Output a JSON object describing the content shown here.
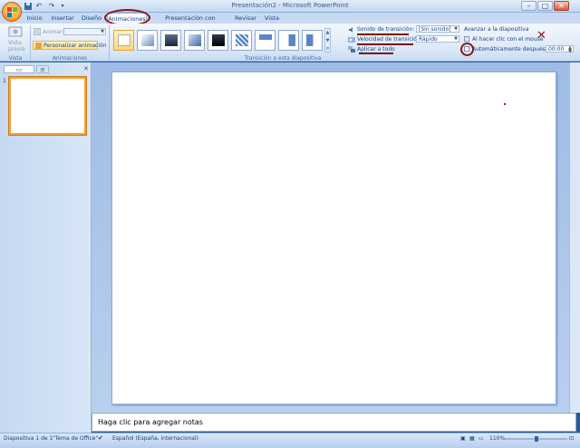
{
  "window": {
    "title": "Presentación2 - Microsoft PowerPoint",
    "min": "–",
    "max": "□",
    "close": "✕"
  },
  "tabs": [
    "Inicio",
    "Insertar",
    "Diseño",
    "Animaciones",
    "Presentación con diapositivas",
    "Revisar",
    "Vista"
  ],
  "ribbon": {
    "preview": {
      "label1": "Vista",
      "label2": "previa",
      "group": "Vista pre..."
    },
    "animations": {
      "animar": "Animar:",
      "custom": "Personalizar animación",
      "group": "Animaciones"
    },
    "transition": {
      "group": "Transición a esta diapositiva",
      "sound_label": "Sonido de transición:",
      "sound_value": "[Sin sonido]",
      "speed_label": "Velocidad de transición:",
      "speed_value": "Rápido",
      "apply_all": "Aplicar a todo"
    },
    "advance": {
      "title": "Avanzar a la diapositiva",
      "on_click": "Al hacer clic con el mouse",
      "auto": "Automáticamente después de:",
      "time": "00:00"
    }
  },
  "panel": {
    "slide_number": "1"
  },
  "notes": {
    "placeholder": "Haga clic para agregar notas"
  },
  "status": {
    "slide": "Diapositiva 1 de 1",
    "theme": "\"Tema de Office\"",
    "language": "Español (España, internacional)",
    "zoom": "110%"
  },
  "colors": {
    "accent": "#f2a03c",
    "annotation": "#8f1414",
    "frame": "#2c5a94"
  }
}
